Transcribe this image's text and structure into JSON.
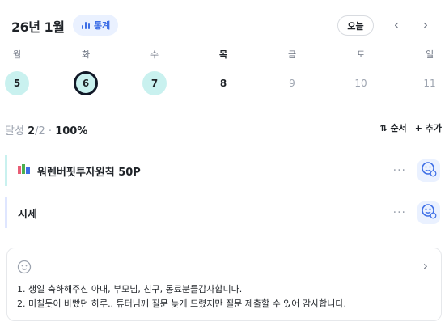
{
  "header": {
    "title": "26년 1월",
    "stats_label": "통계",
    "today_label": "오늘",
    "prev_arrow": "‹",
    "next_arrow": "›"
  },
  "week": [
    {
      "dow": "월",
      "date": "5",
      "state": "done"
    },
    {
      "dow": "화",
      "date": "6",
      "state": "today"
    },
    {
      "dow": "수",
      "date": "7",
      "state": "done"
    },
    {
      "dow": "목",
      "date": "8",
      "state": "plain"
    },
    {
      "dow": "금",
      "date": "9",
      "state": "future"
    },
    {
      "dow": "토",
      "date": "10",
      "state": "future"
    },
    {
      "dow": "일",
      "date": "11",
      "state": "future"
    }
  ],
  "summary": {
    "label": "달성",
    "done": "2",
    "total": "/2",
    "sep": "·",
    "percent": "100%"
  },
  "actions": {
    "sort_label": "순서",
    "add_label": "추가"
  },
  "habits": [
    {
      "title": "워렌버핏투자원칙 50P",
      "accent": "#c9f1ef",
      "has_book_icon": true
    },
    {
      "title": "시세",
      "accent": "#dfe6ff",
      "has_book_icon": false
    }
  ],
  "memo": {
    "line1": "1. 생일 축하해주신 아내, 부모님, 친구, 동료분들감사합니다.",
    "line2": "2. 미칠듯이 바빴던 하루.. 튜터님께 질문 늦게 드렸지만 질문 제출할 수 있어 감사합니다."
  },
  "colors": {
    "accent_blue": "#3d6ee6",
    "done_mint": "#c9f1ef"
  }
}
